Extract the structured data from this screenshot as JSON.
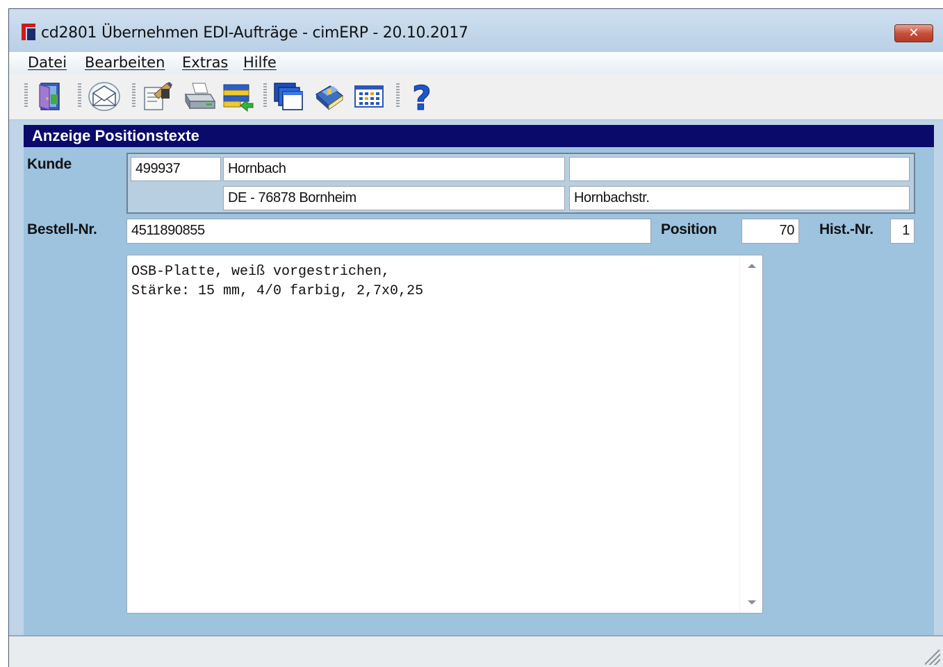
{
  "window": {
    "title": "cd2801 Übernehmen EDI-Aufträge - cimERP - 20.10.2017",
    "close_label": "✕"
  },
  "menu": [
    {
      "label": "Datei"
    },
    {
      "label": "Bearbeiten"
    },
    {
      "label": "Extras"
    },
    {
      "label": "Hilfe"
    }
  ],
  "toolbar": {
    "icons": [
      "exit-door-icon",
      "mail-envelope-icon",
      "edit-form-icon",
      "printer-icon",
      "import-list-icon",
      "windows-icon",
      "book-icon",
      "grid-calendar-icon",
      "help-icon"
    ],
    "help_glyph": "?"
  },
  "section": {
    "title": "Anzeige Positionstexte"
  },
  "form": {
    "kunde_label": "Kunde",
    "kunde_nr": "499937",
    "kunde_name": "Hornbach",
    "kunde_extra": "",
    "kunde_ort": "DE - 76878 Bornheim",
    "kunde_strasse": "Hornbachstr.",
    "bestell_label": "Bestell-Nr.",
    "bestell_nr": "4511890855",
    "position_label": "Position",
    "position_value": "70",
    "hist_label": "Hist.-Nr.",
    "hist_value": "1",
    "positionstext": "OSB-Platte, weiß vorgestrichen,\nStärke: 15 mm, 4/0 farbig, 2,7x0,25"
  },
  "colors": {
    "header_bg": "#0a0a6a",
    "content_bg": "#9dc3df",
    "titlebar_bg": "#c4d8ec"
  }
}
